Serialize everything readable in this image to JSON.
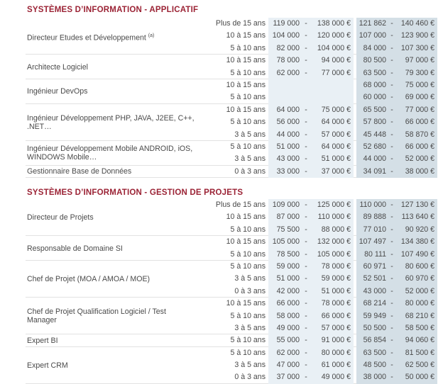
{
  "sections": [
    {
      "title": "SYSTÈMES D’INFORMATION - APPLICATIF",
      "jobs": [
        {
          "title": "Directeur Etudes et Développement",
          "sup": "(a)",
          "rows": [
            {
              "exp": "Plus de 15 ans",
              "a": "119 000",
              "b": "138 000 €",
              "c": "121 862",
              "d": "140 460 €"
            },
            {
              "exp": "10 à 15 ans",
              "a": "104 000",
              "b": "120 000 €",
              "c": "107 000",
              "d": "123 900 €"
            },
            {
              "exp": "5 à 10 ans",
              "a": "82 000",
              "b": "104 000 €",
              "c": "84 000",
              "d": "107 300 €"
            }
          ]
        },
        {
          "title": "Architecte Logiciel",
          "rows": [
            {
              "exp": "10 à 15 ans",
              "a": "78 000",
              "b": "94 000 €",
              "c": "80 500",
              "d": "97 000 €"
            },
            {
              "exp": "5 à 10 ans",
              "a": "62 000",
              "b": "77 000 €",
              "c": "63 500",
              "d": "79 300 €"
            }
          ]
        },
        {
          "title": "Ingénieur DevOps",
          "rows": [
            {
              "exp": "10 à 15 ans",
              "a": "",
              "b": "",
              "c": "68 000",
              "d": "75 000 €"
            },
            {
              "exp": "5 à 10 ans",
              "a": "",
              "b": "",
              "c": "60 000",
              "d": "69 000 €"
            }
          ]
        },
        {
          "title": "Ingénieur Développement PHP, JAVA, J2EE, C++, .NET…",
          "rows": [
            {
              "exp": "10 à 15 ans",
              "a": "64 000",
              "b": "75 000 €",
              "c": "65 500",
              "d": "77 000 €"
            },
            {
              "exp": "5 à 10 ans",
              "a": "56 000",
              "b": "64 000 €",
              "c": "57 800",
              "d": "66 000 €"
            },
            {
              "exp": "3 à 5 ans",
              "a": "44 000",
              "b": "57 000 €",
              "c": "45 448",
              "d": "58 870 €"
            }
          ]
        },
        {
          "title": "Ingénieur Développement Mobile ANDROID, iOS, WINDOWS Mobile…",
          "rows": [
            {
              "exp": "5 à 10 ans",
              "a": "51 000",
              "b": "64 000 €",
              "c": "52 680",
              "d": "66 000 €"
            },
            {
              "exp": "3 à 5 ans",
              "a": "43 000",
              "b": "51 000 €",
              "c": "44 000",
              "d": "52 000 €"
            }
          ]
        },
        {
          "title": "Gestionnaire Base de Données",
          "rows": [
            {
              "exp": "0 à 3 ans",
              "a": "33 000",
              "b": "37 000 €",
              "c": "34 091",
              "d": "38 000 €"
            }
          ]
        }
      ]
    },
    {
      "title": "SYSTÈMES D’INFORMATION - GESTION DE PROJETS",
      "jobs": [
        {
          "title": "Directeur de Projets",
          "rows": [
            {
              "exp": "Plus de 15 ans",
              "a": "109 000",
              "b": "125 000 €",
              "c": "110 000",
              "d": "127 130 €"
            },
            {
              "exp": "10 à 15 ans",
              "a": "87 000",
              "b": "110 000 €",
              "c": "89 888",
              "d": "113 640 €"
            },
            {
              "exp": "5 à 10 ans",
              "a": "75 500",
              "b": "88 000 €",
              "c": "77 010",
              "d": "90 920 €"
            }
          ]
        },
        {
          "title": "Responsable de Domaine SI",
          "rows": [
            {
              "exp": "10 à 15 ans",
              "a": "105 000",
              "b": "132 000 €",
              "c": "107 497",
              "d": "134 380 €"
            },
            {
              "exp": "5 à 10 ans",
              "a": "78 500",
              "b": "105 000 €",
              "c": "80 111",
              "d": "107 490 €"
            }
          ]
        },
        {
          "title": "Chef de Projet (MOA / AMOA / MOE)",
          "rows": [
            {
              "exp": "5 à 10 ans",
              "a": "59 000",
              "b": "78 000 €",
              "c": "60 971",
              "d": "80 600 €"
            },
            {
              "exp": "3 à 5 ans",
              "a": "51 000",
              "b": "59 000 €",
              "c": "52 501",
              "d": "60 970 €"
            },
            {
              "exp": "0 à 3 ans",
              "a": "42 000",
              "b": "51 000 €",
              "c": "43 000",
              "d": "52 000 €"
            }
          ]
        },
        {
          "title": "Chef de Projet Qualification Logiciel / Test Manager",
          "rows": [
            {
              "exp": "10 à 15 ans",
              "a": "66 000",
              "b": "78 000 €",
              "c": "68 214",
              "d": "80 000 €"
            },
            {
              "exp": "5 à 10 ans",
              "a": "58 000",
              "b": "66 000 €",
              "c": "59 949",
              "d": "68 210 €"
            },
            {
              "exp": "3 à 5 ans",
              "a": "49 000",
              "b": "57 000 €",
              "c": "50 500",
              "d": "58 500 €"
            }
          ]
        },
        {
          "title": "Expert BI",
          "rows": [
            {
              "exp": "5 à 10 ans",
              "a": "55 000",
              "b": "91 000 €",
              "c": "56 854",
              "d": "94 060 €"
            }
          ]
        },
        {
          "title": "Expert CRM",
          "rows": [
            {
              "exp": "5 à 10 ans",
              "a": "62 000",
              "b": "80 000 €",
              "c": "63 500",
              "d": "81 500 €"
            },
            {
              "exp": "3 à 5 ans",
              "a": "47 000",
              "b": "61 000 €",
              "c": "48 500",
              "d": "62 500 €"
            },
            {
              "exp": "0 à 3 ans",
              "a": "37 000",
              "b": "49 000 €",
              "c": "38 000",
              "d": "50 000 €"
            }
          ]
        }
      ]
    }
  ]
}
